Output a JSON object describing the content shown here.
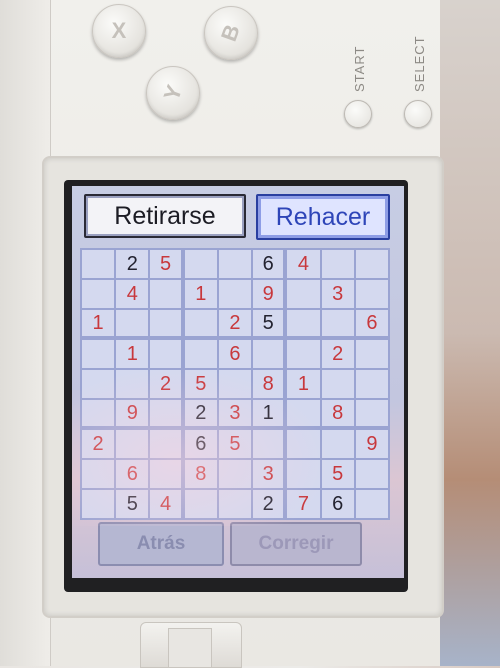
{
  "device": {
    "buttons": {
      "x": "X",
      "b": "B",
      "y": "Y"
    },
    "start_label": "START",
    "select_label": "SELECT"
  },
  "screen": {
    "top_buttons": {
      "retirarse": "Retirarse",
      "rehacer": "Rehacer"
    },
    "bottom_buttons": {
      "atras": "Atrás",
      "corregir": "Corregir"
    },
    "sudoku": {
      "rows": [
        [
          "",
          "2",
          "5",
          "",
          "",
          "6",
          "4",
          "",
          ""
        ],
        [
          "",
          "4",
          "",
          "1",
          "",
          "9",
          "",
          "3",
          ""
        ],
        [
          "1",
          "",
          "",
          "",
          "2",
          "5",
          "",
          "",
          "6"
        ],
        [
          "",
          "1",
          "",
          "",
          "6",
          "",
          "",
          "2",
          ""
        ],
        [
          "",
          "",
          "2",
          "5",
          "",
          "8",
          "1",
          "",
          ""
        ],
        [
          "",
          "9",
          "",
          "2",
          "3",
          "1",
          "",
          "8",
          ""
        ],
        [
          "2",
          "",
          "",
          "6",
          "5",
          "",
          "",
          "",
          "9"
        ],
        [
          "",
          "6",
          "",
          "8",
          "",
          "3",
          "",
          "5",
          ""
        ],
        [
          "",
          "5",
          "4",
          "",
          "",
          "2",
          "7",
          "6",
          ""
        ]
      ],
      "given": [
        [
          0,
          1,
          0,
          0,
          0,
          1,
          0,
          0,
          0
        ],
        [
          0,
          0,
          0,
          0,
          0,
          0,
          0,
          0,
          0
        ],
        [
          0,
          0,
          0,
          0,
          0,
          1,
          0,
          0,
          0
        ],
        [
          0,
          0,
          0,
          0,
          0,
          0,
          0,
          0,
          0
        ],
        [
          0,
          0,
          0,
          0,
          0,
          0,
          0,
          0,
          0
        ],
        [
          0,
          0,
          0,
          1,
          0,
          1,
          0,
          0,
          0
        ],
        [
          0,
          0,
          0,
          1,
          0,
          0,
          0,
          0,
          0
        ],
        [
          0,
          0,
          0,
          0,
          0,
          0,
          0,
          0,
          0
        ],
        [
          0,
          1,
          0,
          0,
          0,
          1,
          0,
          1,
          0
        ]
      ],
      "colors": {
        "given": "#232330",
        "user": "#c8383c"
      }
    }
  }
}
